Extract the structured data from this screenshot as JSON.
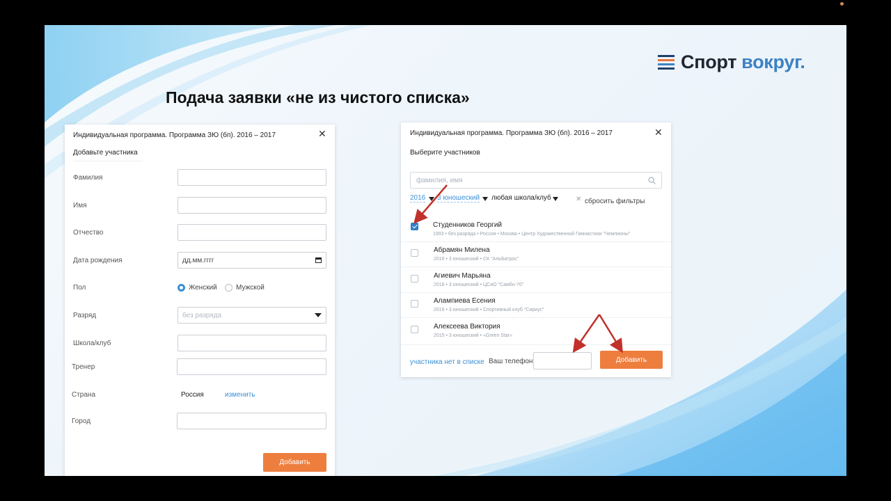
{
  "logo": {
    "part1": "Спорт",
    "part2": "вокруг."
  },
  "slide_title": "Подача заявки «не из чистого списка»",
  "colors": {
    "accent": "#3b8fd6",
    "orange": "#ee7e3e",
    "arrow": "#c0312b"
  },
  "left_dialog": {
    "title": "Индивидуальная программа. Программа ЗЮ (бп). 2016 – 2017",
    "subtitle": "Добавьте участника",
    "fields": {
      "surname": "Фамилия",
      "name": "Имя",
      "patronymic": "Отчество",
      "birth_date": "Дата рождения",
      "birth_date_placeholder": "дд.мм.гггг",
      "gender": "Пол",
      "gender_female": "Женский",
      "gender_male": "Мужской",
      "rank": "Разряд",
      "rank_value": "без разряда",
      "school": "Школа/клуб",
      "coach": "Тренер",
      "country": "Страна",
      "country_value": "Россия",
      "country_change": "изменить",
      "city": "Город"
    },
    "submit": "Добавить"
  },
  "right_dialog": {
    "title": "Индивидуальная программа. Программа ЗЮ (бп). 2016 – 2017",
    "subtitle": "Выберите участников",
    "search_placeholder": "фамилия, имя",
    "filters": {
      "year": "2016",
      "rank": "3 юношеский",
      "school": "любая школа/клуб",
      "reset": "сбросить фильтры"
    },
    "participants": [
      {
        "name": "Студенников Георгий",
        "info": "1993  •  без разряда  •  Россия  •  Москва  •  Центр Художественной Гимнастики \"Чемпионы\"",
        "checked": true
      },
      {
        "name": "Абрамян Милена",
        "info": "2016  •  3 юношеский  •  СК \"АльБатрос\"",
        "checked": false
      },
      {
        "name": "Агиевич Марьяна",
        "info": "2016  •  3 юношеский  •  ЦСиО \"Самбо-70\"",
        "checked": false
      },
      {
        "name": "Алампиева Есения",
        "info": "2016  •  3 юношеский  •  Спортивный клуб \"Сириус\"",
        "checked": false
      },
      {
        "name": "Алексеева Виктория",
        "info": "2015  •  3 юношеский  •  «Green Star»",
        "checked": false
      }
    ],
    "not_in_list": "участника нет в списке",
    "phone_label": "Ваш телефон",
    "submit": "Добавить"
  }
}
